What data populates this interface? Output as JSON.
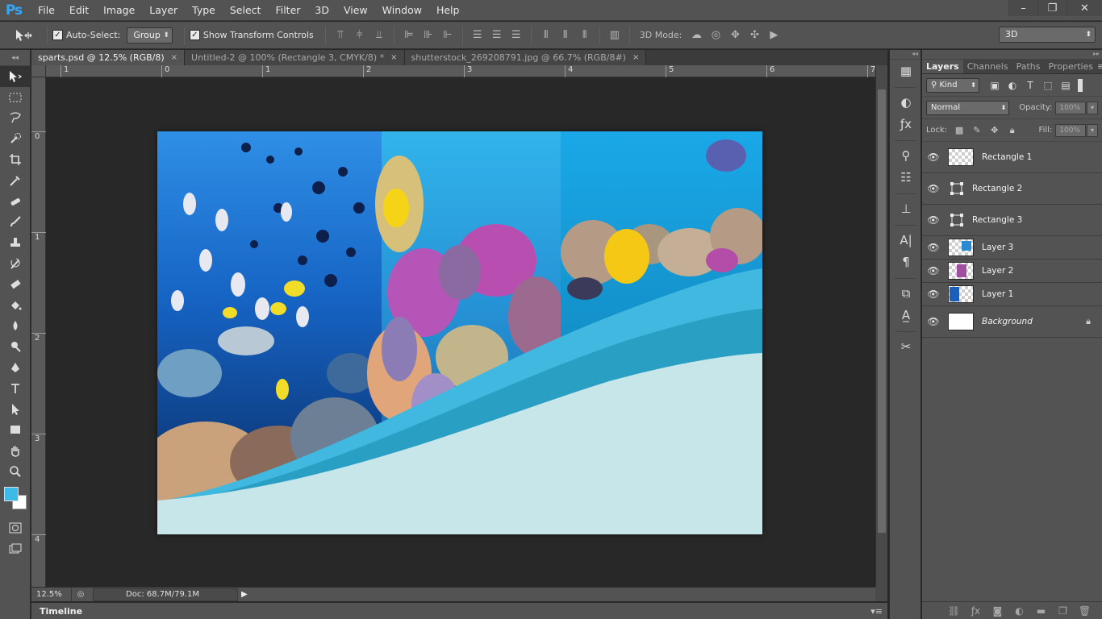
{
  "app": {
    "logo": "Ps"
  },
  "menu": [
    "File",
    "Edit",
    "Image",
    "Layer",
    "Type",
    "Select",
    "Filter",
    "3D",
    "View",
    "Window",
    "Help"
  ],
  "window_controls": {
    "minimize": "–",
    "restore": "❐",
    "close": "✕"
  },
  "options": {
    "auto_select_label": "Auto-Select:",
    "auto_select_checked": true,
    "group_value": "Group",
    "transform_label": "Show Transform Controls",
    "transform_checked": true,
    "mode3d_label": "3D Mode:",
    "workspace_value": "3D"
  },
  "tabs": [
    {
      "label": "sparts.psd @ 12.5% (RGB/8)",
      "close": "×",
      "active": true
    },
    {
      "label": "Untitled-2 @ 100% (Rectangle 3, CMYK/8) *",
      "close": "×",
      "active": false
    },
    {
      "label": "shutterstock_269208791.jpg @ 66.7% (RGB/8#)",
      "close": "×",
      "active": false
    }
  ],
  "ruler_h": [
    "1",
    "0",
    "1",
    "2",
    "3",
    "4",
    "5",
    "6",
    "7"
  ],
  "ruler_v": [
    "0",
    "1",
    "2",
    "3",
    "4"
  ],
  "status": {
    "zoom": "12.5%",
    "doc": "Doc: 68.7M/79.1M"
  },
  "timeline": {
    "label": "Timeline"
  },
  "layers_panel": {
    "tabs": [
      "Layers",
      "Channels",
      "Paths",
      "Properties"
    ],
    "kind_label": "Kind",
    "blend_mode": "Normal",
    "opacity_label": "Opacity:",
    "opacity_value": "100%",
    "lock_label": "Lock:",
    "fill_label": "Fill:",
    "fill_value": "100%",
    "layers": [
      {
        "name": "Rectangle 1",
        "thumb": "raster"
      },
      {
        "name": "Rectangle 2",
        "thumb": "shape"
      },
      {
        "name": "Rectangle 3",
        "thumb": "shape"
      },
      {
        "name": "Layer 3",
        "thumb": "raster"
      },
      {
        "name": "Layer 2",
        "thumb": "raster"
      },
      {
        "name": "Layer 1",
        "thumb": "raster"
      },
      {
        "name": "Background",
        "thumb": "plain"
      }
    ]
  },
  "colors": {
    "foreground": "#3ebae8",
    "background": "#ffffff",
    "wave_light": "#40b8df",
    "wave_dark": "#2a9fc4",
    "doc_bg": "#c7e6ea"
  }
}
